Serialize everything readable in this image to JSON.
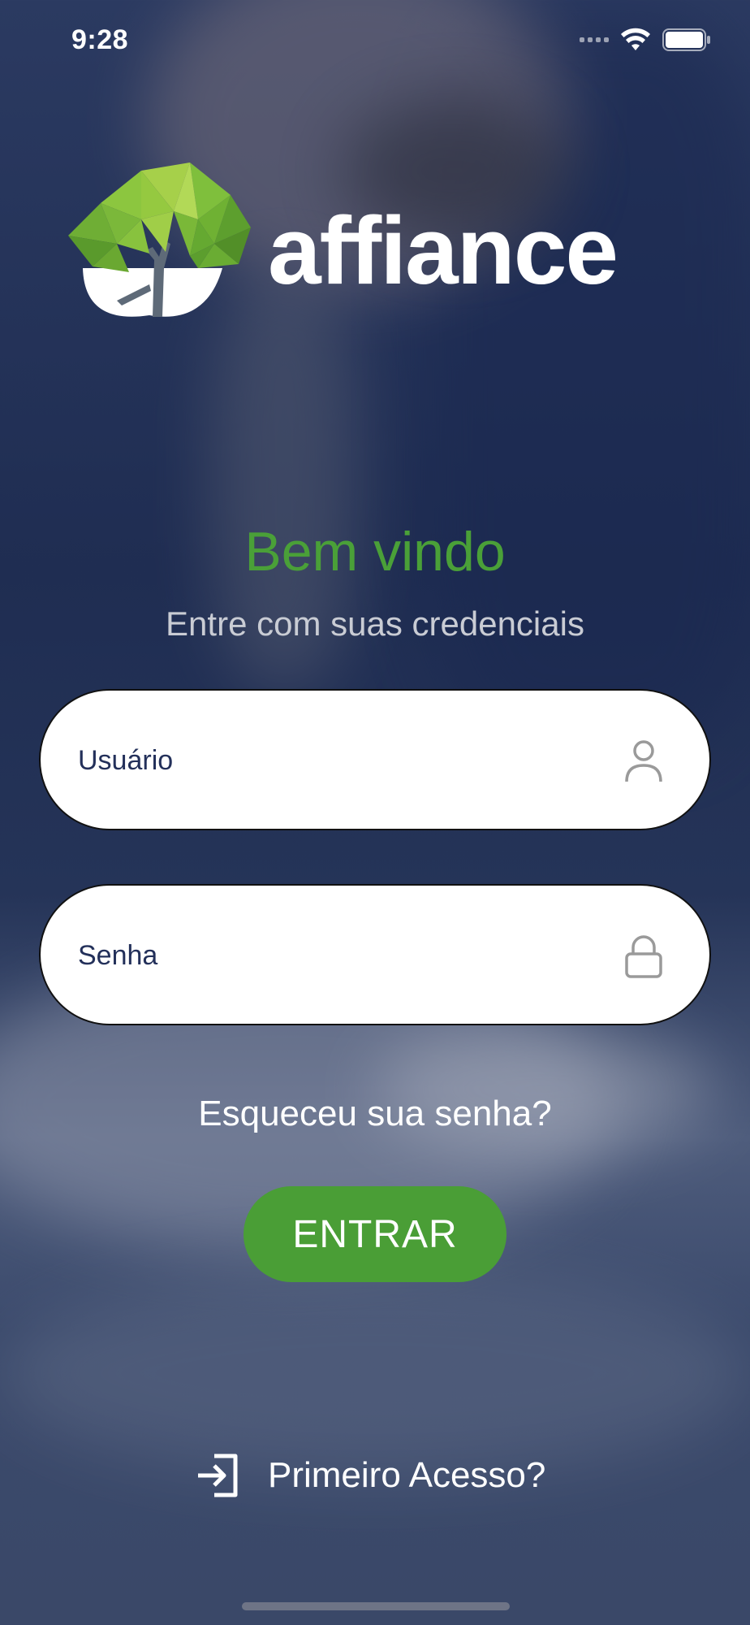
{
  "status_bar": {
    "time": "9:28"
  },
  "brand": {
    "name": "affiance",
    "leaf_color": "#7cc243",
    "text_color": "#ffffff"
  },
  "welcome": {
    "title": "Bem vindo",
    "subtitle": "Entre com suas credenciais"
  },
  "form": {
    "username": {
      "placeholder": "Usuário",
      "value": "",
      "icon": "user-icon"
    },
    "password": {
      "placeholder": "Senha",
      "value": "",
      "icon": "lock-icon"
    }
  },
  "forgot_password": "Esqueceu sua senha?",
  "enter_button": {
    "label": "ENTRAR",
    "color": "#4a9e36"
  },
  "first_access": {
    "label": "Primeiro Acesso?",
    "icon": "login-icon"
  }
}
